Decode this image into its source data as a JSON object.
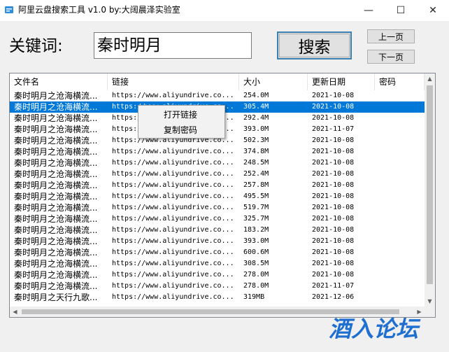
{
  "window": {
    "title": "阿里云盘搜索工具 v1.0  by:大阔晨泽实验室",
    "minimize": "—",
    "maximize": "☐",
    "close": "✕"
  },
  "search": {
    "label": "关键词:",
    "value": "秦时明月",
    "button": "搜索",
    "prev_page": "上一页",
    "next_page": "下一页"
  },
  "table": {
    "columns": [
      "文件名",
      "链接",
      "大小",
      "更新日期",
      "密码"
    ],
    "rows": [
      [
        "秦时明月之沧海横流...",
        "https://www.aliyundrive.co...",
        "254.0M",
        "2021-10-08",
        ""
      ],
      [
        "秦时明月之沧海横流...",
        "https://www.aliyundrive.co...",
        "305.4M",
        "2021-10-08",
        ""
      ],
      [
        "秦时明月之沧海横流...",
        "https://www.aliyundrive.co...",
        "292.4M",
        "2021-10-08",
        ""
      ],
      [
        "秦时明月之沧海横流...",
        "https://www.aliyundrive.co...",
        "393.0M",
        "2021-11-07",
        ""
      ],
      [
        "秦时明月之沧海横流...",
        "https://www.aliyundrive.co...",
        "502.3M",
        "2021-10-08",
        ""
      ],
      [
        "秦时明月之沧海横流...",
        "https://www.aliyundrive.co...",
        "374.8M",
        "2021-10-08",
        ""
      ],
      [
        "秦时明月之沧海横流...",
        "https://www.aliyundrive.co...",
        "248.5M",
        "2021-10-08",
        ""
      ],
      [
        "秦时明月之沧海横流...",
        "https://www.aliyundrive.co...",
        "252.4M",
        "2021-10-08",
        ""
      ],
      [
        "秦时明月之沧海横流...",
        "https://www.aliyundrive.co...",
        "257.8M",
        "2021-10-08",
        ""
      ],
      [
        "秦时明月之沧海横流...",
        "https://www.aliyundrive.co...",
        "495.5M",
        "2021-10-08",
        ""
      ],
      [
        "秦时明月之沧海横流...",
        "https://www.aliyundrive.co...",
        "519.7M",
        "2021-10-08",
        ""
      ],
      [
        "秦时明月之沧海横流...",
        "https://www.aliyundrive.co...",
        "325.7M",
        "2021-10-08",
        ""
      ],
      [
        "秦时明月之沧海横流...",
        "https://www.aliyundrive.co...",
        "183.2M",
        "2021-10-08",
        ""
      ],
      [
        "秦时明月之沧海横流...",
        "https://www.aliyundrive.co...",
        "393.0M",
        "2021-10-08",
        ""
      ],
      [
        "秦时明月之沧海横流...",
        "https://www.aliyundrive.co...",
        "600.6M",
        "2021-10-08",
        ""
      ],
      [
        "秦时明月之沧海横流...",
        "https://www.aliyundrive.co...",
        "308.5M",
        "2021-10-08",
        ""
      ],
      [
        "秦时明月之沧海横流...",
        "https://www.aliyundrive.co...",
        "278.0M",
        "2021-10-08",
        ""
      ],
      [
        "秦时明月之沧海横流...",
        "https://www.aliyundrive.co...",
        "278.0M",
        "2021-11-07",
        ""
      ],
      [
        "秦时明月之天行九歌...",
        "https://www.aliyundrive.co...",
        "319MB",
        "2021-12-06",
        ""
      ]
    ],
    "selected_row": 1
  },
  "context_menu": {
    "items": [
      "打开链接",
      "复制密码"
    ]
  },
  "watermark": {
    "text": "酒入论坛",
    "color": "#1f6fd1"
  },
  "colors": {
    "selection": "#0078d7",
    "button_focus": "#3c7fb1"
  },
  "icons": {
    "app": "app-icon",
    "scroll_up": "scroll-up-arrow-icon",
    "scroll_down": "scroll-down-arrow-icon",
    "scroll_left": "scroll-left-arrow-icon",
    "scroll_right": "scroll-right-arrow-icon"
  }
}
